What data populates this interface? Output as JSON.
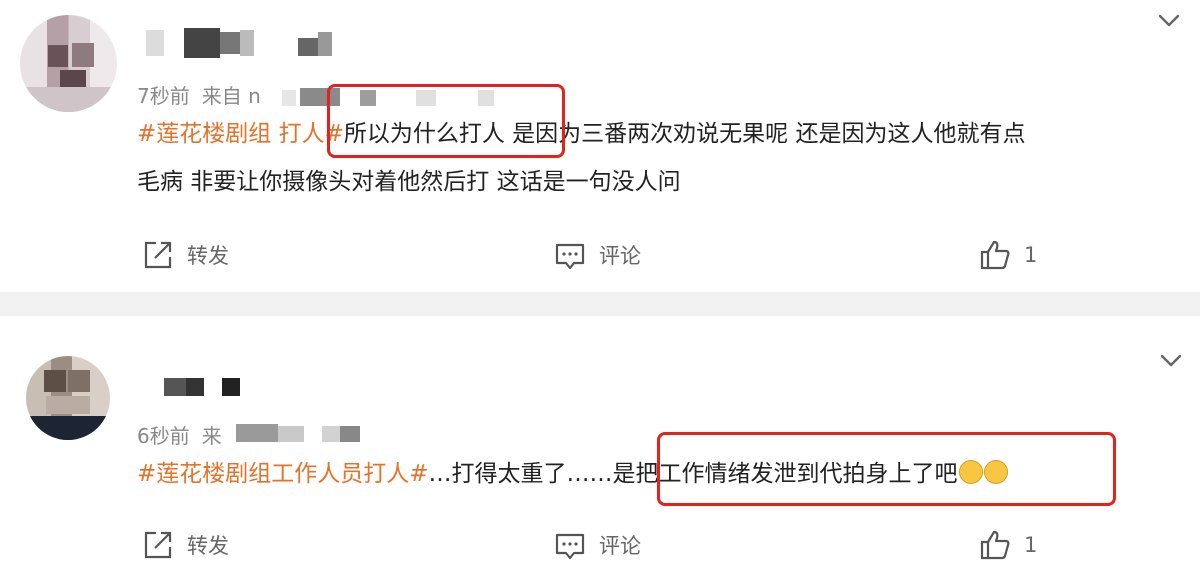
{
  "posts": [
    {
      "time": "7秒前",
      "source_prefix": "来自 n",
      "content": {
        "hashtag": "#莲花楼剧组 打人#",
        "text_after_tag": "所以为什么打人",
        "text_rest": " 是因为三番两次劝说无果呢 还是因为这人他就有点",
        "line2": "毛病 非要让你摄像头对着他然后打 这话是一句没人问"
      },
      "actions": {
        "repost": "转发",
        "comment": "评论",
        "likes": "1"
      }
    },
    {
      "time": "6秒前",
      "source_prefix": "来",
      "content": {
        "hashtag": "#莲花楼剧组工作人员打人#",
        "text_before_box": "…打得太重了……",
        "text_boxed": "是把工作情绪发泄到代拍身上了吧"
      },
      "actions": {
        "repost": "转发",
        "comment": "评论",
        "likes": "1"
      }
    }
  ],
  "icons": [
    "chevron-down-icon",
    "repost-icon",
    "comment-icon",
    "like-icon",
    "grin-sweat-emoji"
  ],
  "colors": {
    "hashtag": "#e5722a",
    "highlight_box": "#e2221d",
    "meta": "#888888",
    "separator": "#f2f2f2"
  }
}
